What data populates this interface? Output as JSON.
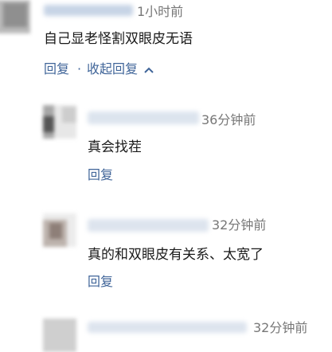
{
  "comment": {
    "time": "1小时前",
    "text": "自己显老怪割双眼皮无语",
    "reply_label": "回复",
    "separator": "·",
    "collapse_label": "收起回复",
    "collapse_icon": "chevron-up-icon"
  },
  "replies": [
    {
      "time": "36分钟前",
      "text": "真会找茬",
      "reply_label": "回复"
    },
    {
      "time": "32分钟前",
      "text": "真的和双眼皮有关系、太宽了",
      "reply_label": "回复"
    },
    {
      "time": "32分钟前"
    }
  ],
  "colors": {
    "link": "#406599",
    "meta": "#777777",
    "text": "#1a1a1a",
    "background": "#ffffff"
  }
}
